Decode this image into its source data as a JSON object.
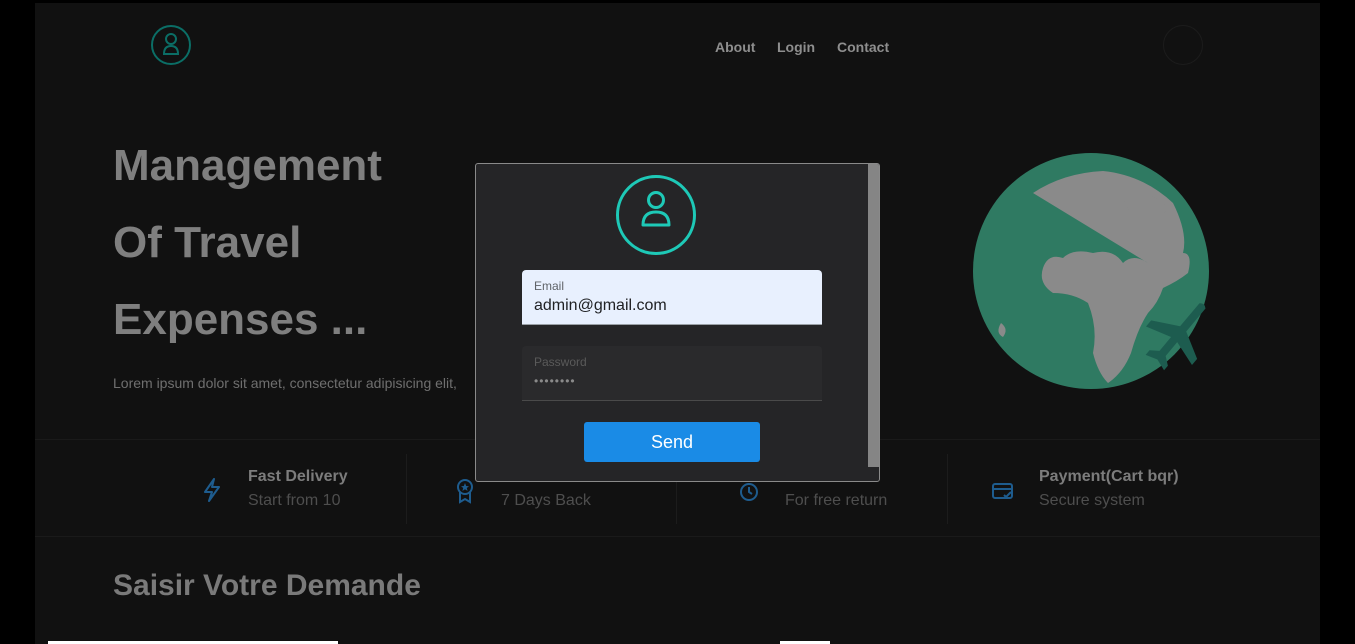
{
  "header": {
    "nav": [
      "About",
      "Login",
      "Contact"
    ]
  },
  "hero": {
    "lines": [
      "Management",
      "Of Travel",
      "Expenses ..."
    ],
    "description": "Lorem ipsum dolor sit amet, consectetur adipisicing elit,"
  },
  "features": [
    {
      "icon": "lightning-icon",
      "title": "Fast Delivery",
      "subtitle": "Start from 10"
    },
    {
      "icon": "award-icon",
      "title": "",
      "subtitle": "7 Days Back"
    },
    {
      "icon": "clock-icon",
      "title": "",
      "subtitle": "For free return"
    },
    {
      "icon": "credit-card-icon",
      "title": "Payment(Cart bqr)",
      "subtitle": "Secure system"
    }
  ],
  "section": {
    "title": "Saisir Votre Demande"
  },
  "login_modal": {
    "email": {
      "label": "Email",
      "value": "admin@gmail.com"
    },
    "password": {
      "label": "Password",
      "value": "••••••••"
    },
    "send_label": "Send"
  },
  "colors": {
    "accent": "#1ec9b7",
    "button": "#1a8be6",
    "globe_sea": "#2f7a62",
    "globe_land": "#8a8a8a"
  }
}
